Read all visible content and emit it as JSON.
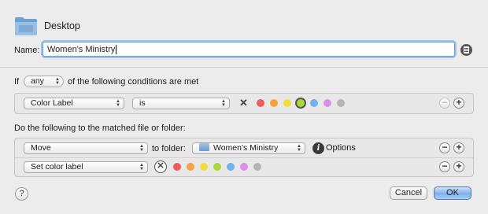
{
  "window": {
    "title": "Desktop",
    "folder_icon": "folder-icon"
  },
  "name_field": {
    "label": "Name:",
    "value": "Women's Ministry"
  },
  "conditions": {
    "prefix": "If",
    "match_selector": "any",
    "suffix": "of the following conditions are met",
    "rows": [
      {
        "attribute": "Color Label",
        "operator": "is"
      }
    ]
  },
  "actions": {
    "heading": "Do the following to the matched file or folder:",
    "move": {
      "action": "Move",
      "to_label": "to folder:",
      "folder": "Women's Ministry",
      "options_label": "Options"
    },
    "set_label": {
      "action": "Set color label"
    }
  },
  "colors": {
    "labels": [
      "#f25b5b",
      "#f5a33b",
      "#f1de3c",
      "#a8d83a",
      "#6fb2f0",
      "#dc8ee8",
      "#b5b5b5"
    ],
    "selected_index": 3,
    "accent": "#7fb0ec"
  },
  "buttons": {
    "help": "?",
    "cancel": "Cancel",
    "ok": "OK"
  }
}
